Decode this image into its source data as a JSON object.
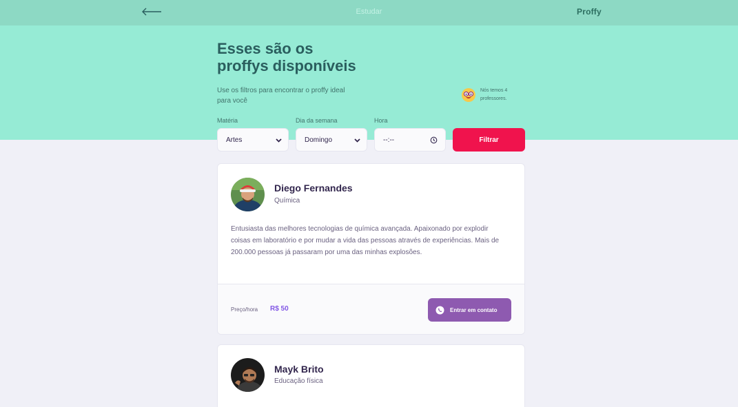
{
  "topbar": {
    "back_icon": "arrow-left-icon",
    "title": "Estudar",
    "logo": "Proffy"
  },
  "hero": {
    "title_line1": "Esses são os",
    "title_line2": "proffys disponíveis",
    "subtitle": "Use os filtros para encontrar o proffy ideal para você",
    "teachers_text": "Nós temos 4 professores.",
    "emoji_icon": "smiling-nerd-icon"
  },
  "filters": {
    "subject_label": "Matéria",
    "subject_value": "Artes",
    "weekday_label": "Dia da semana",
    "weekday_value": "Domingo",
    "time_label": "Hora",
    "time_value": "--:--",
    "submit_label": "Filtrar"
  },
  "teachers": [
    {
      "name": "Diego Fernandes",
      "subject": "Química",
      "bio": "Entusiasta das melhores tecnologias de química avançada. Apaixonado por explodir coisas em laboratório e por mudar a vida das pessoas através de experiências. Mais de 200.000 pessoas já passaram por uma das minhas explosões.",
      "price_label": "Preço/hora",
      "price": "R$ 50",
      "contact_label": "Entrar em contato"
    },
    {
      "name": "Mayk Brito",
      "subject": "Educação física"
    }
  ],
  "colors": {
    "hero": "#96ebd5",
    "topbar": "#8dd9c4",
    "filter_button": "#f0134d",
    "contact_button": "#8e5ab0",
    "price": "#8257e5"
  }
}
